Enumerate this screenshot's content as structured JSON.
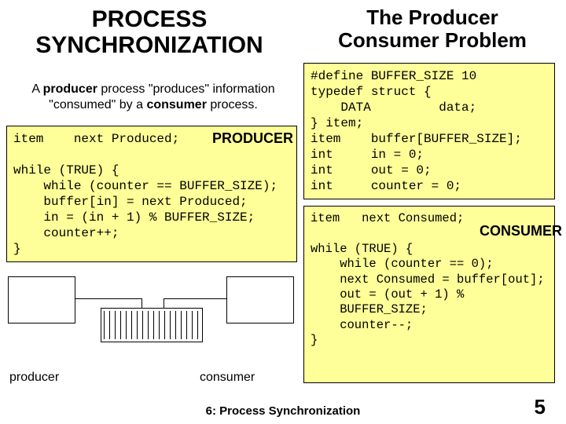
{
  "title_left_l1": "PROCESS",
  "title_left_l2": "SYNCHRONIZATION",
  "title_right_l1": "The Producer",
  "title_right_l2": "Consumer Problem",
  "desc": {
    "pre1": "A ",
    "b1": "producer",
    "mid1": " process \"produces\" information",
    "line2_pre": "\"consumed\" by a ",
    "b2": "consumer",
    "line2_post": " process."
  },
  "defs_code": "#define BUFFER_SIZE 10\ntypedef struct {\n    DATA         data;\n} item;\nitem    buffer[BUFFER_SIZE];\nint     in = 0;\nint     out = 0;\nint     counter = 0;",
  "producer_code": "item    next Produced;\n\nwhile (TRUE) {\n    while (counter == BUFFER_SIZE);\n    buffer[in] = next Produced;\n    in = (in + 1) % BUFFER_SIZE;\n    counter++;\n}",
  "consumer_code": "item   next Consumed;\n\nwhile (TRUE) {\n    while (counter == 0);\n    next Consumed = buffer[out];\n    out = (out + 1) %\n    BUFFER_SIZE;\n    counter--;\n}",
  "labels": {
    "producer_role": "PRODUCER",
    "consumer_role": "CONSUMER",
    "producer": "producer",
    "consumer": "consumer"
  },
  "footer": "6: Process Synchronization",
  "page_number": "5"
}
